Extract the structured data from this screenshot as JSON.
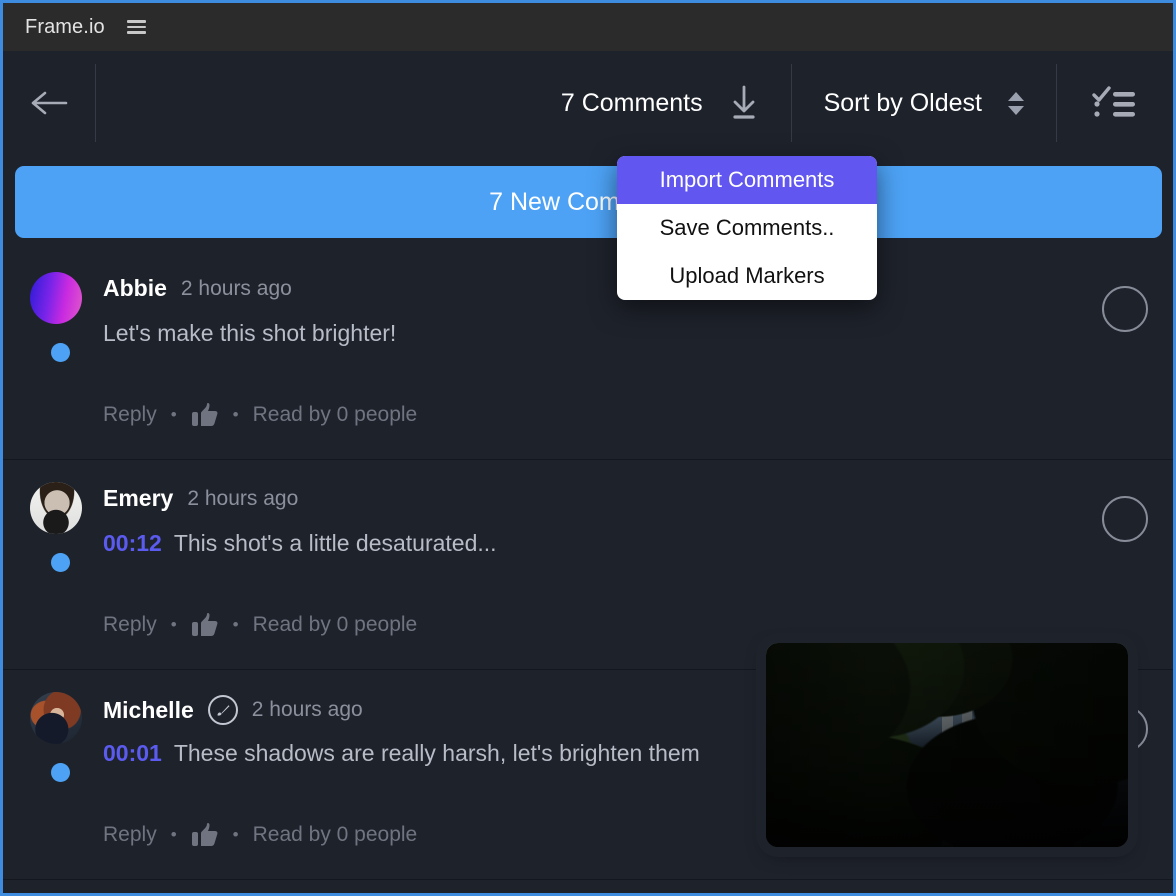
{
  "titlebar": {
    "brand": "Frame.io",
    "menu_icon": "hamburger-icon"
  },
  "toolbar": {
    "back_icon": "back-arrow-icon",
    "comments_count_label": "7 Comments",
    "download_icon": "download-icon",
    "sort_label": "Sort by Oldest",
    "stepper_icon": "up-down-chevron-icon",
    "checklist_icon": "checklist-icon"
  },
  "banner": {
    "label": "7 New Comments"
  },
  "menu": {
    "items": [
      {
        "label": "Import Comments",
        "active": true
      },
      {
        "label": "Save Comments..",
        "active": false
      },
      {
        "label": "Upload Markers",
        "active": false
      }
    ]
  },
  "comments": [
    {
      "name": "Abbie",
      "time": "2 hours ago",
      "timestamp": "",
      "text": "Let's make this shot brighter!",
      "reply_label": "Reply",
      "like_icon": "thumbs-up-icon",
      "read_label": "Read by 0 people",
      "annotated": false,
      "unread": true,
      "complete_toggle": "circle-outline-icon"
    },
    {
      "name": "Emery",
      "time": "2 hours ago",
      "timestamp": "00:12",
      "text": "This shot's a little desaturated...",
      "reply_label": "Reply",
      "like_icon": "thumbs-up-icon",
      "read_label": "Read by 0 people",
      "annotated": false,
      "unread": true,
      "complete_toggle": "circle-outline-icon"
    },
    {
      "name": "Michelle",
      "time": "2 hours ago",
      "timestamp": "00:01",
      "text": "These shadows are really harsh, let's brighten them",
      "reply_label": "Reply",
      "like_icon": "thumbs-up-icon",
      "read_label": "Read by 0 people",
      "annotated": true,
      "annotation_icon": "paintbrush-circle-icon",
      "unread": true,
      "complete_toggle": "circle-outline-icon"
    }
  ],
  "thumbnail": {
    "name": "forest-video-thumbnail"
  },
  "colors": {
    "accent_blue": "#4da2f5",
    "menu_highlight": "#6157f0",
    "timestamp_purple": "#5b5bf0",
    "panel_bg": "#1e222b",
    "titlebar_bg": "#2b2b2b",
    "focus_border": "#3d8ce0"
  }
}
